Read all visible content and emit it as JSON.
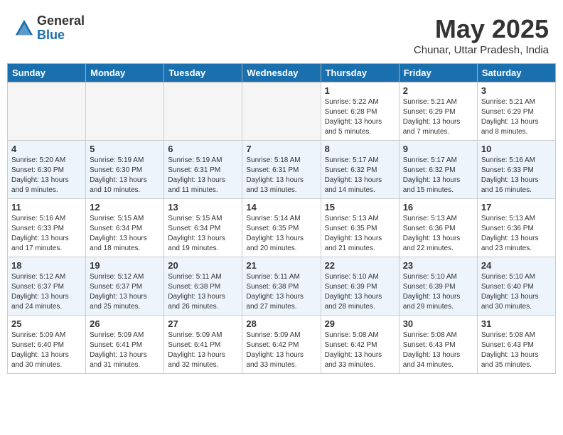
{
  "header": {
    "logo_general": "General",
    "logo_blue": "Blue",
    "month_title": "May 2025",
    "location": "Chunar, Uttar Pradesh, India"
  },
  "weekdays": [
    "Sunday",
    "Monday",
    "Tuesday",
    "Wednesday",
    "Thursday",
    "Friday",
    "Saturday"
  ],
  "weeks": [
    [
      {
        "day": "",
        "info": ""
      },
      {
        "day": "",
        "info": ""
      },
      {
        "day": "",
        "info": ""
      },
      {
        "day": "",
        "info": ""
      },
      {
        "day": "1",
        "info": "Sunrise: 5:22 AM\nSunset: 6:28 PM\nDaylight: 13 hours\nand 5 minutes."
      },
      {
        "day": "2",
        "info": "Sunrise: 5:21 AM\nSunset: 6:29 PM\nDaylight: 13 hours\nand 7 minutes."
      },
      {
        "day": "3",
        "info": "Sunrise: 5:21 AM\nSunset: 6:29 PM\nDaylight: 13 hours\nand 8 minutes."
      }
    ],
    [
      {
        "day": "4",
        "info": "Sunrise: 5:20 AM\nSunset: 6:30 PM\nDaylight: 13 hours\nand 9 minutes."
      },
      {
        "day": "5",
        "info": "Sunrise: 5:19 AM\nSunset: 6:30 PM\nDaylight: 13 hours\nand 10 minutes."
      },
      {
        "day": "6",
        "info": "Sunrise: 5:19 AM\nSunset: 6:31 PM\nDaylight: 13 hours\nand 11 minutes."
      },
      {
        "day": "7",
        "info": "Sunrise: 5:18 AM\nSunset: 6:31 PM\nDaylight: 13 hours\nand 13 minutes."
      },
      {
        "day": "8",
        "info": "Sunrise: 5:17 AM\nSunset: 6:32 PM\nDaylight: 13 hours\nand 14 minutes."
      },
      {
        "day": "9",
        "info": "Sunrise: 5:17 AM\nSunset: 6:32 PM\nDaylight: 13 hours\nand 15 minutes."
      },
      {
        "day": "10",
        "info": "Sunrise: 5:16 AM\nSunset: 6:33 PM\nDaylight: 13 hours\nand 16 minutes."
      }
    ],
    [
      {
        "day": "11",
        "info": "Sunrise: 5:16 AM\nSunset: 6:33 PM\nDaylight: 13 hours\nand 17 minutes."
      },
      {
        "day": "12",
        "info": "Sunrise: 5:15 AM\nSunset: 6:34 PM\nDaylight: 13 hours\nand 18 minutes."
      },
      {
        "day": "13",
        "info": "Sunrise: 5:15 AM\nSunset: 6:34 PM\nDaylight: 13 hours\nand 19 minutes."
      },
      {
        "day": "14",
        "info": "Sunrise: 5:14 AM\nSunset: 6:35 PM\nDaylight: 13 hours\nand 20 minutes."
      },
      {
        "day": "15",
        "info": "Sunrise: 5:13 AM\nSunset: 6:35 PM\nDaylight: 13 hours\nand 21 minutes."
      },
      {
        "day": "16",
        "info": "Sunrise: 5:13 AM\nSunset: 6:36 PM\nDaylight: 13 hours\nand 22 minutes."
      },
      {
        "day": "17",
        "info": "Sunrise: 5:13 AM\nSunset: 6:36 PM\nDaylight: 13 hours\nand 23 minutes."
      }
    ],
    [
      {
        "day": "18",
        "info": "Sunrise: 5:12 AM\nSunset: 6:37 PM\nDaylight: 13 hours\nand 24 minutes."
      },
      {
        "day": "19",
        "info": "Sunrise: 5:12 AM\nSunset: 6:37 PM\nDaylight: 13 hours\nand 25 minutes."
      },
      {
        "day": "20",
        "info": "Sunrise: 5:11 AM\nSunset: 6:38 PM\nDaylight: 13 hours\nand 26 minutes."
      },
      {
        "day": "21",
        "info": "Sunrise: 5:11 AM\nSunset: 6:38 PM\nDaylight: 13 hours\nand 27 minutes."
      },
      {
        "day": "22",
        "info": "Sunrise: 5:10 AM\nSunset: 6:39 PM\nDaylight: 13 hours\nand 28 minutes."
      },
      {
        "day": "23",
        "info": "Sunrise: 5:10 AM\nSunset: 6:39 PM\nDaylight: 13 hours\nand 29 minutes."
      },
      {
        "day": "24",
        "info": "Sunrise: 5:10 AM\nSunset: 6:40 PM\nDaylight: 13 hours\nand 30 minutes."
      }
    ],
    [
      {
        "day": "25",
        "info": "Sunrise: 5:09 AM\nSunset: 6:40 PM\nDaylight: 13 hours\nand 30 minutes."
      },
      {
        "day": "26",
        "info": "Sunrise: 5:09 AM\nSunset: 6:41 PM\nDaylight: 13 hours\nand 31 minutes."
      },
      {
        "day": "27",
        "info": "Sunrise: 5:09 AM\nSunset: 6:41 PM\nDaylight: 13 hours\nand 32 minutes."
      },
      {
        "day": "28",
        "info": "Sunrise: 5:09 AM\nSunset: 6:42 PM\nDaylight: 13 hours\nand 33 minutes."
      },
      {
        "day": "29",
        "info": "Sunrise: 5:08 AM\nSunset: 6:42 PM\nDaylight: 13 hours\nand 33 minutes."
      },
      {
        "day": "30",
        "info": "Sunrise: 5:08 AM\nSunset: 6:43 PM\nDaylight: 13 hours\nand 34 minutes."
      },
      {
        "day": "31",
        "info": "Sunrise: 5:08 AM\nSunset: 6:43 PM\nDaylight: 13 hours\nand 35 minutes."
      }
    ]
  ]
}
